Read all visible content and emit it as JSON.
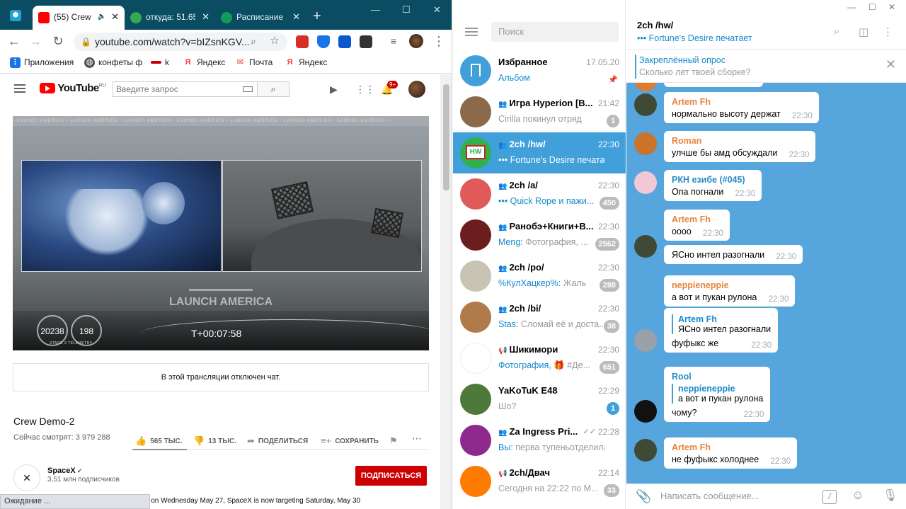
{
  "chrome": {
    "tabs": [
      {
        "title": "(55) Crew",
        "color": "#ff0000",
        "active": true
      },
      {
        "title": "откуда: 51.65",
        "color": "#34a853",
        "active": false
      },
      {
        "title": "Расписание",
        "color": "#0f9d58",
        "active": false
      }
    ],
    "new_tab": "+",
    "url": "youtube.com/watch?v=bIZsnKGV...",
    "bookmarks": [
      "Приложения",
      "конфеты ф",
      "k",
      "Яндекс",
      "Почта",
      "Яндекс"
    ],
    "status": "Ожидание ..."
  },
  "youtube": {
    "logo": "YouTube",
    "region": "RU",
    "search_placeholder": "Введите запрос",
    "bell_count": "9+",
    "player": {
      "strip_text": "• LAUNCH AMERICA • LAUNCH AMERICA • LAUNCH AMERICA • LAUNCH AMERICA • LAUNCH AMERICA • LAUNCH AMERICA • LAUNCH AMERICA •",
      "banner": "LAUNCH AMERICA",
      "gauge_speed": "20238",
      "gauge_alt": "198",
      "telemetry_label": "STAGE 2 TELEMETRY",
      "timer": "T+00:07:58"
    },
    "chat_disabled": "В этой трансляции отключен чат.",
    "video_title": "Crew Demo-2",
    "viewers": "Сейчас смотрят: 3 979 288",
    "likes": "565 ТЫС.",
    "dislikes": "13 ТЫС.",
    "like_ratio": 0.977,
    "share": "ПОДЕЛИТЬСЯ",
    "save": "СОХРАНИТЬ",
    "channel": {
      "name": "SpaceX",
      "subs": "3,51 млн подписчиков"
    },
    "subscribe": "ПОДПИСАТЬСЯ",
    "description": "After standing down from launch on Wednesday May 27, SpaceX is now targeting Saturday, May 30"
  },
  "telegram": {
    "search_placeholder": "Поиск",
    "chats": [
      {
        "name": "Избранное",
        "time": "17.05.20",
        "sender": "",
        "preview": "Альбом",
        "badge": "",
        "group": false,
        "pinned": true,
        "avatar": "#419fd9"
      },
      {
        "name": "Игра Hyperion [В...",
        "time": "21:42",
        "sender": "",
        "preview": "Cirilla покинул отряд",
        "badge": "1",
        "group": true,
        "avatar": "#8a6a4a"
      },
      {
        "name": "2ch /hw/",
        "time": "22:30",
        "sender": "",
        "preview": "••• Fortune's Desire печатает",
        "badge": "",
        "group": true,
        "selected": true,
        "avatar": "#2fb24e"
      },
      {
        "name": "2ch /a/",
        "time": "22:30",
        "sender": "•••",
        "preview": "Quick Rope и пажи...",
        "badge": "450",
        "group": true,
        "avatar": "#e05a5a"
      },
      {
        "name": "Ранобэ+Книги+В...",
        "time": "22:30",
        "sender": "Meng:",
        "preview": "Фотография, ...",
        "badge": "2562",
        "group": true,
        "avatar": "#6b1e1e"
      },
      {
        "name": "2ch /po/",
        "time": "22:30",
        "sender": "%КулХацкер%:",
        "preview": "Жаль",
        "badge": "288",
        "group": true,
        "avatar": "#c9c3b4"
      },
      {
        "name": "2ch /bi/",
        "time": "22:30",
        "sender": "Stas:",
        "preview": "Сломай её и доста...",
        "badge": "38",
        "group": true,
        "avatar": "#b07a4a"
      },
      {
        "name": "Шикимори",
        "time": "22:30",
        "sender": "Фотография,",
        "preview": "🎁 #Де...",
        "badge": "651",
        "group": false,
        "channel": true,
        "avatar": "#ffffff"
      },
      {
        "name": "YaKoTuK E48",
        "time": "22:29",
        "sender": "",
        "preview": "Шо?",
        "badge": "1",
        "badge_blue": true,
        "group": false,
        "avatar": "#4d7a3a"
      },
      {
        "name": "Za Ingress Pri...",
        "time": "22:28",
        "sender": "Вы:",
        "preview": "перва тупеньотделилаь",
        "badge": "",
        "group": true,
        "check": true,
        "avatar": "#8e2a8e"
      },
      {
        "name": "2ch/Двач",
        "time": "22:14",
        "sender": "",
        "preview": "Сегодня на 22:22 по М...",
        "badge": "33",
        "group": false,
        "channel": true,
        "avatar": "#ff7b00"
      }
    ],
    "header": {
      "title": "2ch /hw/",
      "typing": "••• Fortune's Desire печатает"
    },
    "pinned": {
      "title": "Закреплённый опрос",
      "text": "Сколько лет твоей сборке?"
    },
    "messages": [
      {
        "author": "Artem Fh",
        "author_color": "#e8853a",
        "text": "нормально высоту держат",
        "time": "22:30"
      },
      {
        "author": "Roman",
        "author_color": "#e8853a",
        "text": "улчше бы амд обсуждали",
        "time": "22:30"
      },
      {
        "author": "РКН езибе (#045)",
        "author_color": "#2a8cc4",
        "text": "Опа погнали",
        "time": "22:30"
      },
      {
        "author": "Artem Fh",
        "author_color": "#e8853a",
        "text": "оооо",
        "time": "22:30"
      },
      {
        "author": "",
        "text": "ЯСно интел разогнали",
        "time": "22:30"
      },
      {
        "author": "neppieneppie",
        "author_color": "#e8853a",
        "text": "а вот и пукан рулона",
        "time": "22:30"
      },
      {
        "author": "",
        "reply_author": "Artem Fh",
        "reply_text": "ЯСно интел разогнали",
        "text": "фуфыкс же",
        "time": "22:30"
      },
      {
        "author": "Rool",
        "author_color": "#2a8cc4",
        "reply_author": "neppieneppie",
        "reply_text": "а вот и пукан рулона",
        "text": "чому?",
        "time": "22:30"
      },
      {
        "author": "Artem Fh",
        "author_color": "#e8853a",
        "text": "не фуфыкс холоднее",
        "time": "22:30"
      }
    ],
    "compose_placeholder": "Написать сообщение..."
  }
}
